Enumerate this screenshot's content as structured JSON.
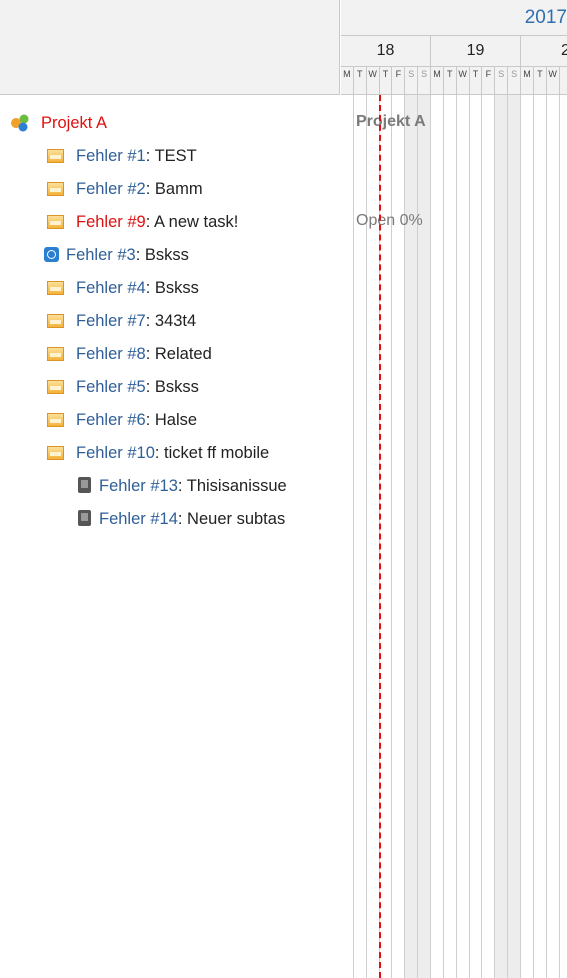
{
  "gantt_header": {
    "year": "2017",
    "weeks": [
      "18",
      "19",
      "2"
    ],
    "day_letters": [
      "M",
      "T",
      "W",
      "T",
      "F",
      "S",
      "S",
      "M",
      "T",
      "W",
      "T",
      "F",
      "S",
      "S",
      "M",
      "T",
      "W"
    ]
  },
  "tree": {
    "project": {
      "label": "Projekt A",
      "icon": "project-icon"
    },
    "issues": [
      {
        "key": "Fehler #1",
        "subject": ": TEST",
        "icon": "task-icon",
        "overdue": false
      },
      {
        "key": "Fehler #2",
        "subject": ": Bamm",
        "icon": "task-icon",
        "overdue": false
      },
      {
        "key": "Fehler #9",
        "subject": ": A new task!",
        "icon": "task-icon",
        "overdue": true
      },
      {
        "key": "Fehler #3",
        "subject": ": Bskss",
        "icon": "clock-icon",
        "overdue": false
      },
      {
        "key": "Fehler #4",
        "subject": ": Bskss",
        "icon": "task-icon",
        "overdue": false
      },
      {
        "key": "Fehler #7",
        "subject": ": 343t4",
        "icon": "task-icon",
        "overdue": false
      },
      {
        "key": "Fehler #8",
        "subject": ": Related",
        "icon": "task-icon",
        "overdue": false
      },
      {
        "key": "Fehler #5",
        "subject": ": Bskss",
        "icon": "task-icon",
        "overdue": false
      },
      {
        "key": "Fehler #6",
        "subject": ": Halse",
        "icon": "task-icon",
        "overdue": false
      },
      {
        "key": "Fehler #10",
        "subject": ": ticket ff mobile",
        "icon": "task-icon",
        "overdue": false
      },
      {
        "key": "Fehler #13",
        "subject": ": Thisisanissue",
        "icon": "mobile-icon",
        "overdue": false
      },
      {
        "key": "Fehler #14",
        "subject": ": Neuer subtas",
        "icon": "mobile-icon",
        "overdue": false
      }
    ]
  },
  "gantt_labels": {
    "project_label": "Projekt A",
    "task9_status": "Open 0%"
  },
  "colors": {
    "link": "#2f5f98",
    "overdue": "#e01010",
    "today_line": "#e01010",
    "year_text": "#2f6fb0"
  }
}
